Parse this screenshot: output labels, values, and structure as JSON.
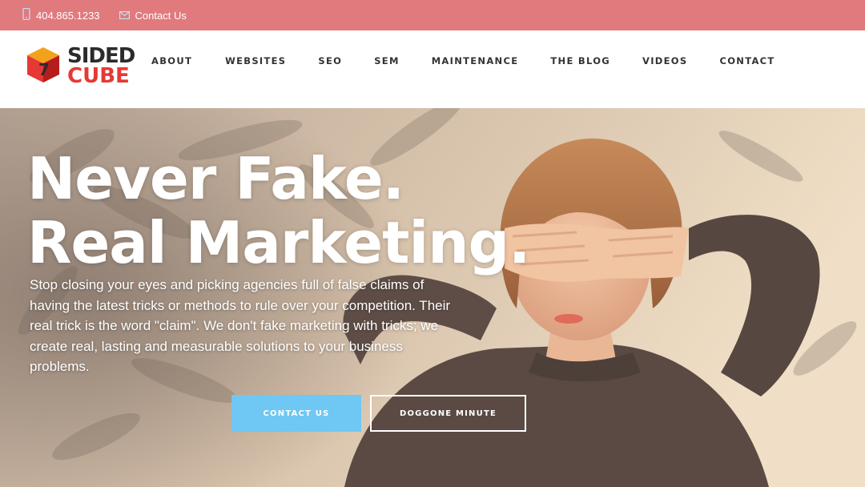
{
  "topbar": {
    "phone": "404.865.1233",
    "contact": "Contact Us",
    "phone_icon": "phone-icon",
    "contact_icon": "mail-icon"
  },
  "logo": {
    "line1": "SIDED",
    "line2": "CUBE",
    "mark": "7"
  },
  "nav": {
    "items": [
      "ABOUT",
      "WEBSITES",
      "SEO",
      "SEM",
      "MAINTENANCE",
      "THE BLOG",
      "VIDEOS",
      "CONTACT"
    ]
  },
  "hero": {
    "headline_line1": "Never Fake.",
    "headline_line2": "Real Marketing.",
    "subtext": "Stop closing your eyes and picking agencies full of false claims of having the latest tricks or methods to rule over your competition. Their real trick is the word \"claim\". We don't fake marketing with tricks; we create real, lasting and measurable solutions to your business problems.",
    "primary_button": "CONTACT US",
    "secondary_button": "DOGGONE MINUTE"
  },
  "colors": {
    "topbar": "#e07a7c",
    "accent_button": "#6fc7f3",
    "logo_red": "#e53935",
    "logo_dark": "#2b2b2b",
    "logo_yellow": "#f2a21a"
  }
}
